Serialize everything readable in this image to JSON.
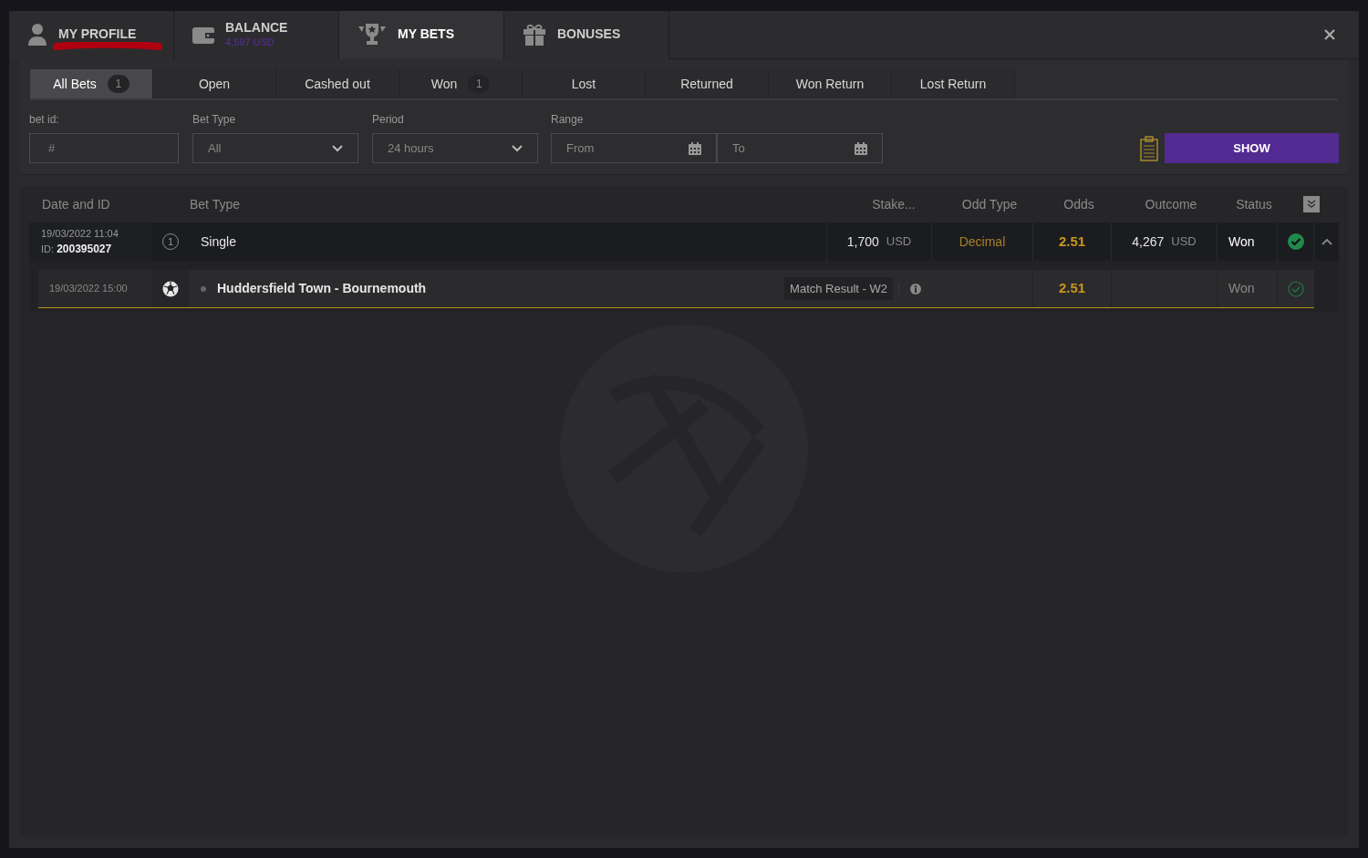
{
  "header_tabs": [
    {
      "kind": "profile",
      "label": "MY PROFILE",
      "selected": false
    },
    {
      "kind": "balance",
      "label": "BALANCE",
      "sub": "4,597 USD",
      "selected": false
    },
    {
      "kind": "bets",
      "label": "MY BETS",
      "selected": true
    },
    {
      "kind": "bonuses",
      "label": "BONUSES",
      "selected": false
    }
  ],
  "filter_tabs": [
    {
      "label": "All Bets",
      "count": "1",
      "selected": true
    },
    {
      "label": "Open",
      "selected": false
    },
    {
      "label": "Cashed out",
      "selected": false
    },
    {
      "label": "Won",
      "count": "1",
      "selected": false
    },
    {
      "label": "Lost",
      "selected": false
    },
    {
      "label": "Returned",
      "selected": false
    },
    {
      "label": "Won Return",
      "selected": false
    },
    {
      "label": "Lost Return",
      "selected": false
    }
  ],
  "filters": {
    "bet_id": {
      "label": "bet id:",
      "placeholder": "#"
    },
    "bet_type": {
      "label": "Bet Type",
      "value": "All"
    },
    "period": {
      "label": "Period",
      "value": "24 hours"
    },
    "range": {
      "label": "Range",
      "from": "From",
      "to": "To"
    },
    "show_button": "SHOW"
  },
  "table": {
    "columns": [
      "Date and ID",
      "Bet Type",
      "Stake...",
      "Odd Type",
      "Odds",
      "Outcome",
      "Status"
    ],
    "rows": [
      {
        "date": "19/03/2022 11:04",
        "id_label": "ID:",
        "id": "200395027",
        "count": "1",
        "bet_type": "Single",
        "stake": "1,700",
        "stake_currency": "USD",
        "odd_type": "Decimal",
        "odds": "2.51",
        "outcome": "4,267",
        "outcome_currency": "USD",
        "status": "Won",
        "expanded": true,
        "events": [
          {
            "date": "19/03/2022 15:00",
            "match": "Huddersfield Town - Bournemouth",
            "market": "Match Result - W2",
            "odds": "2.51",
            "status": "Won"
          }
        ]
      }
    ]
  }
}
